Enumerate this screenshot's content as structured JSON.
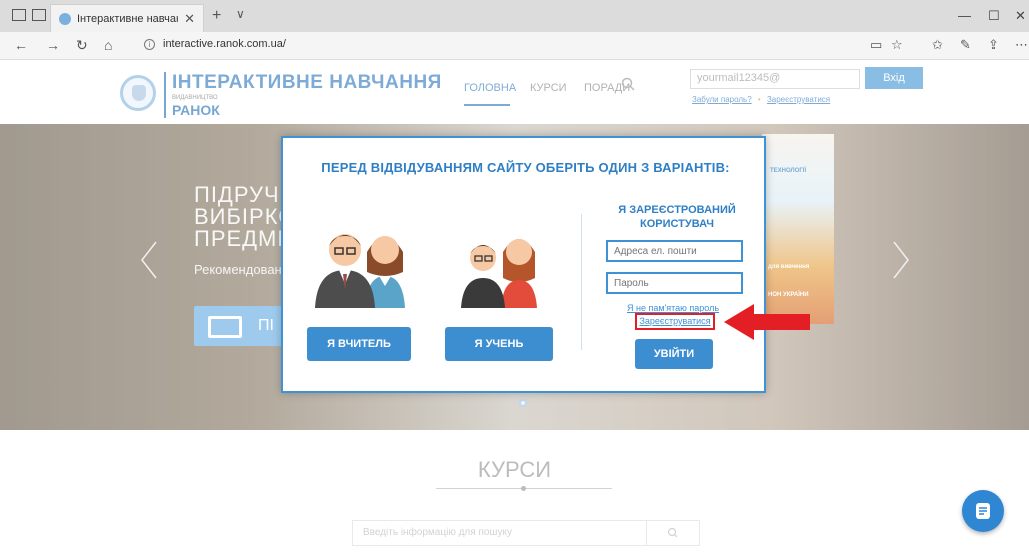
{
  "browser": {
    "tab_title": "Інтерактивне навчання",
    "tab_close": "✕",
    "new_tab": "+",
    "tab_menu": "∨",
    "url": "interactive.ranok.com.ua/",
    "controls": {
      "minimize": "—",
      "maximize": "☐",
      "close": "✕"
    }
  },
  "header": {
    "logo_title": "ІНТЕРАКТИВНЕ НАВЧАННЯ",
    "logo_publisher": "ВИДАВНИЦТВО",
    "logo_brand": "РАНОК",
    "menu": [
      "ГОЛОВНА",
      "КУРСИ",
      "ПОРАДИ"
    ],
    "email_value": "yourmail12345@",
    "login_button": "Вхід",
    "forgot_link": "Забули пароль?",
    "separator": "•",
    "register_link": "Зареєструватися"
  },
  "hero": {
    "lines": [
      "ПІДРУЧН",
      "ВИБІРКО",
      "ПРЕДМЕТ"
    ],
    "subtitle": "Рекомендован",
    "button_label": "ПІ",
    "promo_texts": [
      "ТЕХНОЛОГІЇ",
      "для вивчення",
      "НОН УКРАЇНИ"
    ]
  },
  "modal": {
    "title": "ПЕРЕД ВІДВІДУВАННЯМ САЙТУ ОБЕРІТЬ ОДИН З ВАРІАНТІВ:",
    "teacher_button": "Я ВЧИТЕЛЬ",
    "student_button": "Я УЧЕНЬ",
    "registered_title": "Я ЗАРЕЄСТРОВАНИЙ КОРИСТУВАЧ",
    "email_placeholder": "Адреса ел. пошти",
    "password_placeholder": "Пароль",
    "forgot_link": "Я не пам'ятаю пароль",
    "register_link": "Зареєструватися",
    "enter_button": "УВІЙТИ"
  },
  "courses": {
    "title": "КУРСИ",
    "search_placeholder": "Введіть інформацію для пошуку"
  },
  "colors": {
    "accent": "#3d8ed0",
    "highlight": "#e31e24"
  }
}
